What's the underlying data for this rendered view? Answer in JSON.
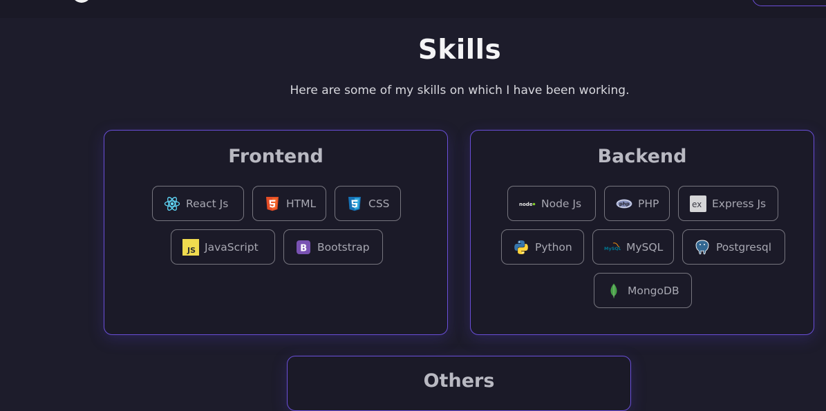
{
  "header": {
    "title": "Skills",
    "subtitle": "Here are some of my skills on which I have been working."
  },
  "frontend": {
    "title": "Frontend",
    "items": [
      {
        "label": "React Js",
        "icon": "react-icon"
      },
      {
        "label": "HTML",
        "icon": "html5-icon"
      },
      {
        "label": "CSS",
        "icon": "css3-icon"
      },
      {
        "label": "JavaScript",
        "icon": "javascript-icon"
      },
      {
        "label": "Bootstrap",
        "icon": "bootstrap-icon"
      }
    ]
  },
  "backend": {
    "title": "Backend",
    "items": [
      {
        "label": "Node Js",
        "icon": "nodejs-icon"
      },
      {
        "label": "PHP",
        "icon": "php-icon"
      },
      {
        "label": "Express Js",
        "icon": "express-icon"
      },
      {
        "label": "Python",
        "icon": "python-icon"
      },
      {
        "label": "MySQL",
        "icon": "mysql-icon"
      },
      {
        "label": "Postgresql",
        "icon": "postgresql-icon"
      },
      {
        "label": "MongoDB",
        "icon": "mongodb-icon"
      }
    ]
  },
  "others": {
    "title": "Others"
  },
  "colors": {
    "background": "#1d1c2b",
    "accent_border": "#6a4fd9",
    "chip_border": "#77767f",
    "card_title": "#b9b9c2"
  }
}
